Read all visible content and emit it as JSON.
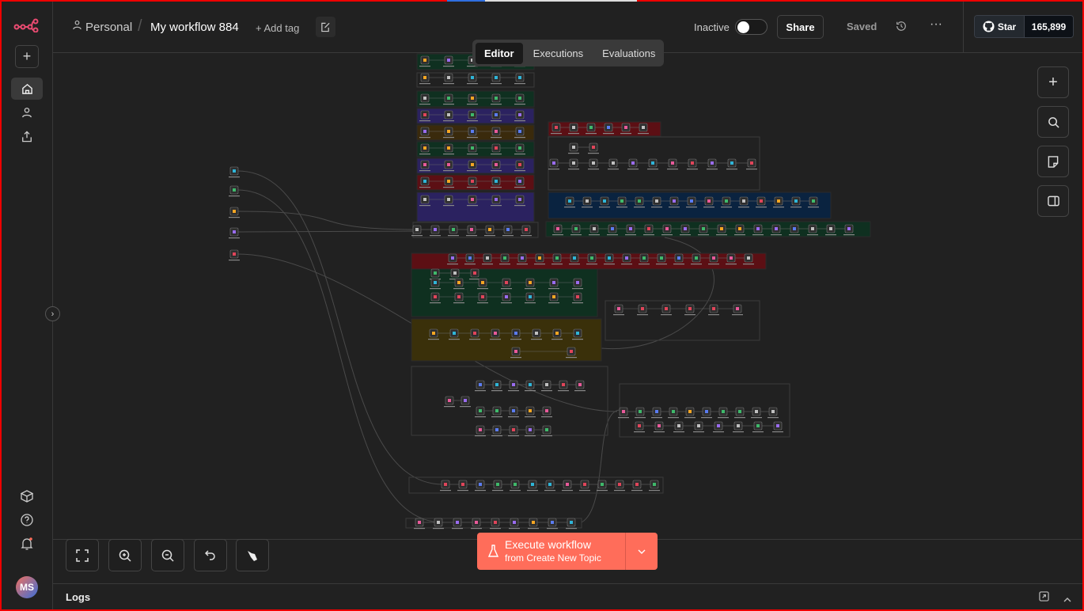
{
  "header": {
    "project": "Personal",
    "workflow_name": "My workflow 884",
    "add_tag": "+ Add tag",
    "status_label": "Inactive",
    "share": "Share",
    "saved": "Saved",
    "github_star": "Star",
    "star_count": "165,899"
  },
  "tabs": [
    {
      "label": "Editor",
      "active": true
    },
    {
      "label": "Executions",
      "active": false
    },
    {
      "label": "Evaluations",
      "active": false
    }
  ],
  "execute": {
    "title": "Execute workflow",
    "subtitle": "from Create New Topic"
  },
  "logs": {
    "label": "Logs"
  },
  "user": {
    "initials": "MS"
  },
  "colors": {
    "accent": "#ff6d5a",
    "brand": "#ea4b71"
  }
}
